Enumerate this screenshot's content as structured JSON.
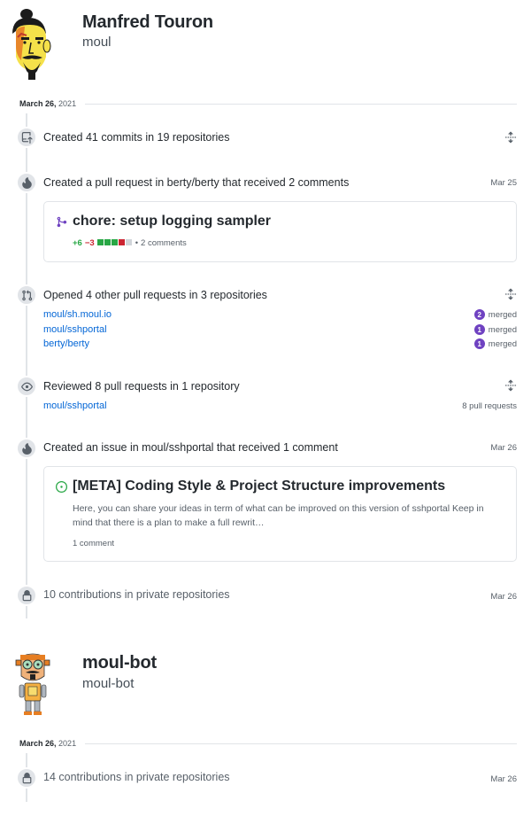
{
  "users": [
    {
      "name": "Manfred Touron",
      "login": "moul",
      "date": {
        "day": "March 26,",
        "year": "2021"
      }
    },
    {
      "name": "moul-bot",
      "login": "moul-bot",
      "date": {
        "day": "March 26,",
        "year": "2021"
      }
    }
  ],
  "events": {
    "commits": {
      "title": "Created 41 commits in 19 repositories"
    },
    "pr": {
      "title": "Created a pull request in berty/berty that received 2 comments",
      "date": "Mar 25",
      "card_title": "chore: setup logging sampler",
      "additions": "+6",
      "deletions": "−3",
      "comments": "2 comments",
      "diff_bar": {
        "green": 3,
        "red": 1,
        "grey": 1
      }
    },
    "opened": {
      "title": "Opened 4 other pull requests in 3 repositories",
      "repos": [
        {
          "name": "moul/sh.moul.io",
          "count": "2",
          "status": "merged"
        },
        {
          "name": "moul/sshportal",
          "count": "1",
          "status": "merged"
        },
        {
          "name": "berty/berty",
          "count": "1",
          "status": "merged"
        }
      ]
    },
    "reviewed": {
      "title": "Reviewed 8 pull requests in 1 repository",
      "repo": "moul/sshportal",
      "count": "8 pull requests"
    },
    "issue": {
      "title": "Created an issue in moul/sshportal that received 1 comment",
      "date": "Mar 26",
      "card_title": "[META] Coding Style & Project Structure improvements",
      "body": "Here, you can share your ideas in term of what can be improved on this version of sshportal Keep in mind that there is a plan to make a full rewrit…",
      "comments": "1 comment"
    },
    "private1": {
      "title": "10 contributions in private repositories",
      "date": "Mar 26"
    },
    "private2": {
      "title": "14 contributions in private repositories",
      "date": "Mar 26"
    }
  },
  "colors": {
    "link": "#0366d6",
    "merged": "#6f42c1",
    "added": "#28a745",
    "deleted": "#cb2431",
    "line": "#e1e4e8"
  },
  "icons": [
    "repo-push-icon",
    "flame-icon",
    "git-pull-request-icon",
    "eye-icon",
    "lock-icon",
    "unfold-icon",
    "git-merge-icon",
    "issue-opened-icon"
  ]
}
